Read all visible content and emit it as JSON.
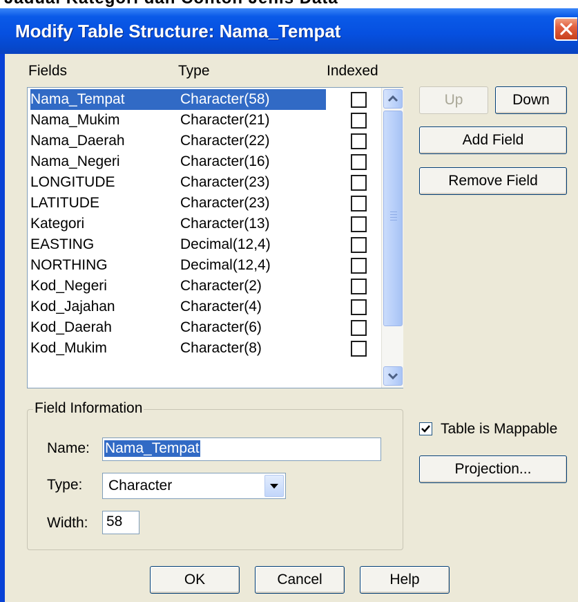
{
  "window": {
    "caption_above": "Jadual Kategori dan Contoh Jenis Data",
    "title": "Modify Table Structure: Nama_Tempat"
  },
  "list": {
    "headers": {
      "fields": "Fields",
      "type": "Type",
      "indexed": "Indexed"
    },
    "rows": [
      {
        "name": "Nama_Tempat",
        "type": "Character(58)",
        "indexed": false,
        "selected": true
      },
      {
        "name": "Nama_Mukim",
        "type": "Character(21)",
        "indexed": false
      },
      {
        "name": "Nama_Daerah",
        "type": "Character(22)",
        "indexed": false
      },
      {
        "name": "Nama_Negeri",
        "type": "Character(16)",
        "indexed": false
      },
      {
        "name": "LONGITUDE",
        "type": "Character(23)",
        "indexed": false
      },
      {
        "name": "LATITUDE",
        "type": "Character(23)",
        "indexed": false
      },
      {
        "name": "Kategori",
        "type": "Character(13)",
        "indexed": false
      },
      {
        "name": "EASTING",
        "type": "Decimal(12,4)",
        "indexed": false
      },
      {
        "name": "NORTHING",
        "type": "Decimal(12,4)",
        "indexed": false
      },
      {
        "name": "Kod_Negeri",
        "type": "Character(2)",
        "indexed": false
      },
      {
        "name": "Kod_Jajahan",
        "type": "Character(4)",
        "indexed": false
      },
      {
        "name": "Kod_Daerah",
        "type": "Character(6)",
        "indexed": false
      },
      {
        "name": "Kod_Mukim",
        "type": "Character(8)",
        "indexed": false
      }
    ]
  },
  "buttons": {
    "up": "Up",
    "down": "Down",
    "add_field": "Add Field",
    "remove_field": "Remove Field",
    "projection": "Projection...",
    "ok": "OK",
    "cancel": "Cancel",
    "help": "Help"
  },
  "field_info": {
    "group_title": "Field Information",
    "name_label": "Name:",
    "name_value": "Nama_Tempat",
    "type_label": "Type:",
    "type_value": "Character",
    "width_label": "Width:",
    "width_value": "58"
  },
  "mappable": {
    "label": "Table is Mappable",
    "checked": true
  },
  "icons": {
    "close": "close-icon",
    "scroll_up": "chevron-up-icon",
    "scroll_down": "chevron-down-icon",
    "dropdown": "dropdown-arrow-icon",
    "check": "checkmark-icon"
  },
  "colors": {
    "title_bar": "#0650e0",
    "selection": "#316ac5",
    "dialog_bg": "#ece9d8",
    "close_button": "#e26040"
  }
}
